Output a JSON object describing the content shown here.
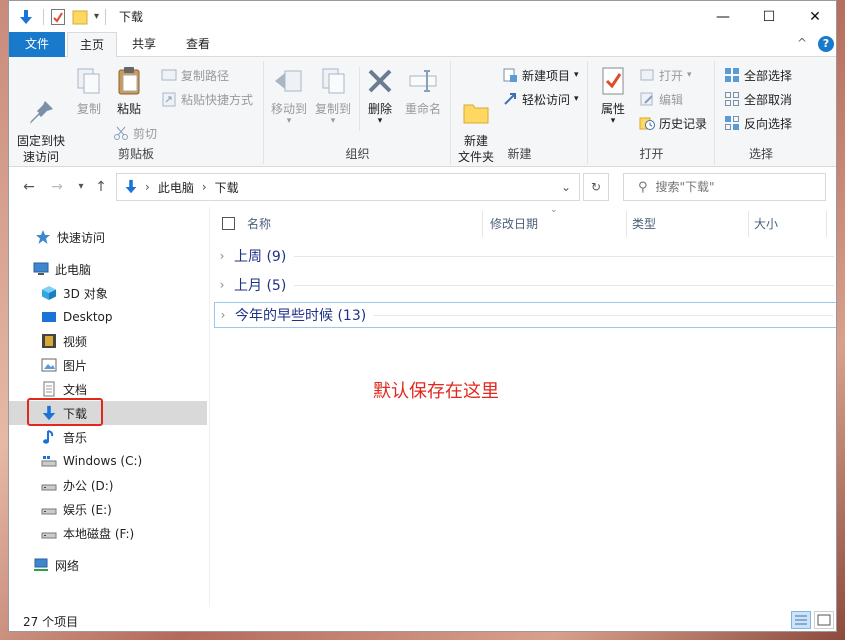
{
  "window": {
    "title": "下载",
    "controls": {
      "minimize": "—",
      "maximize": "☐",
      "close": "✕"
    }
  },
  "tabs": [
    {
      "label": "文件"
    },
    {
      "label": "主页"
    },
    {
      "label": "共享"
    },
    {
      "label": "查看"
    }
  ],
  "help_glyph": "?",
  "collapse_glyph": "^",
  "ribbon": {
    "clipboard": {
      "label": "剪贴板",
      "pin": "固定到快\n速访问",
      "copy": "复制",
      "paste": "粘贴",
      "copy_path": "复制路径",
      "paste_shortcut": "粘贴快捷方式",
      "cut": "剪切"
    },
    "organize": {
      "label": "组织",
      "move_to": "移动到",
      "copy_to": "复制到",
      "delete": "删除",
      "rename": "重命名"
    },
    "new": {
      "label": "新建",
      "new_folder": "新建\n文件夹",
      "new_item": "新建项目",
      "easy_access": "轻松访问"
    },
    "open": {
      "label": "打开",
      "properties": "属性",
      "open": "打开",
      "edit": "编辑",
      "history": "历史记录"
    },
    "select": {
      "label": "选择",
      "select_all": "全部选择",
      "select_none": "全部取消",
      "invert": "反向选择"
    }
  },
  "address": {
    "parts": [
      "此电脑",
      "下载"
    ],
    "search_placeholder": "搜索\"下载\""
  },
  "nav": {
    "quick_access": "快速访问",
    "this_pc": "此电脑",
    "items": [
      {
        "label": "3D 对象",
        "icon": "cube-icon"
      },
      {
        "label": "Desktop",
        "icon": "desktop-icon"
      },
      {
        "label": "视频",
        "icon": "video-icon"
      },
      {
        "label": "图片",
        "icon": "picture-icon"
      },
      {
        "label": "文档",
        "icon": "document-icon"
      },
      {
        "label": "下载",
        "icon": "download-icon"
      },
      {
        "label": "音乐",
        "icon": "music-icon"
      },
      {
        "label": "Windows (C:)",
        "icon": "drive-icon"
      },
      {
        "label": "办公 (D:)",
        "icon": "drive-icon"
      },
      {
        "label": "娱乐 (E:)",
        "icon": "drive-icon"
      },
      {
        "label": "本地磁盘 (F:)",
        "icon": "drive-icon"
      }
    ],
    "network": "网络"
  },
  "columns": {
    "name": "名称",
    "date": "修改日期",
    "type": "类型",
    "size": "大小"
  },
  "groups": [
    {
      "label": "上周 (9)"
    },
    {
      "label": "上月 (5)"
    },
    {
      "label": "今年的早些时候 (13)"
    }
  ],
  "annotation": "默认保存在这里",
  "status": {
    "count": "27 个项目"
  },
  "colors": {
    "accent": "#1979ca",
    "highlight_red": "#e0281e",
    "group_text": "#1e3287",
    "column_text": "#4c607a"
  }
}
